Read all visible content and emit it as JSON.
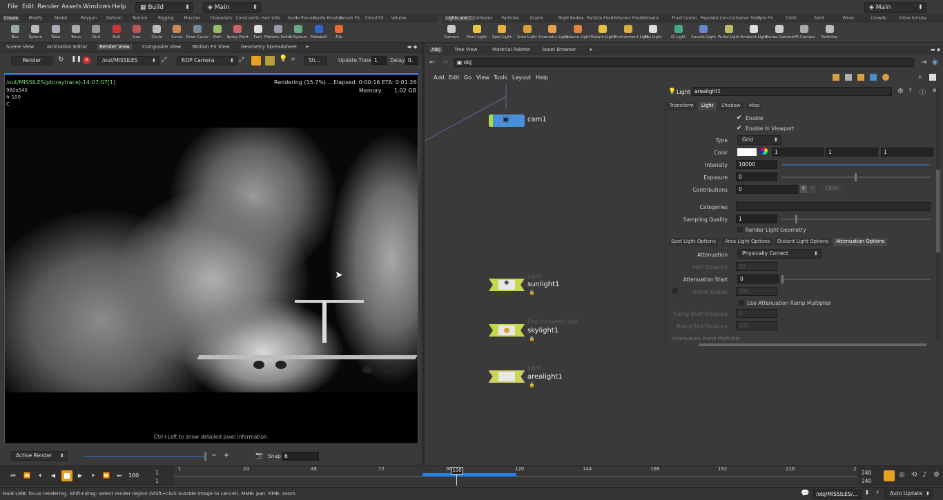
{
  "menubar": {
    "items": [
      "File",
      "Edit",
      "Render",
      "Assets",
      "Windows",
      "Help"
    ],
    "desktop": "Build",
    "context": "Main",
    "right_context": "Main"
  },
  "shelf_left": {
    "tabs": [
      "Create",
      "Modify",
      "Model",
      "Polygon",
      "Deform",
      "Texture",
      "Rigging",
      "Muscles",
      "Characters",
      "Constraints",
      "Hair Utils",
      "Guide Process",
      "Guide Brushes",
      "Terrain FX",
      "Cloud FX",
      "Volume"
    ],
    "tools": [
      "Box",
      "Sphere",
      "Tube",
      "Torus",
      "Grid",
      "Null",
      "Line",
      "Circle",
      "Curve",
      "Draw Curve",
      "Path",
      "Spray Paint",
      "Font",
      "Platonic Solids",
      "L-System",
      "Metaball",
      "File"
    ]
  },
  "shelf_right": {
    "tabs": [
      "Lights and C.",
      "Collisions",
      "Particles",
      "Grains",
      "Rigid Bodies",
      "Particle Fluids",
      "Viscous Fluids",
      "Oceans",
      "Fluid Contai.",
      "Populate Con.",
      "Container Tools",
      "Pyro FX",
      "Cloth",
      "Solid",
      "Wires",
      "Crowds",
      "Drive Simula."
    ],
    "tools": [
      "Camera",
      "Point Light",
      "Spot Light",
      "Area Light",
      "Geometry Light",
      "Volume Light",
      "Distant Light",
      "Environment Light",
      "Sky Light",
      "GI Light",
      "Caustic Light",
      "Portal Light",
      "Ambient Light",
      "Stereo Camera",
      "VR Camera",
      "Switcher"
    ]
  },
  "left_pane": {
    "tabs": [
      "Scene View",
      "Animation Editor",
      "Render View",
      "Composite View",
      "Motion FX View",
      "Geometry Spreadsheet"
    ],
    "toolbar": {
      "render": "Render",
      "rop_path": "/out/MISSILES",
      "camera": "ROP Camera",
      "sh": "Sh...",
      "update_time_label": "Update Time",
      "update_time": "1",
      "delay_label": "Delay",
      "delay": "0."
    },
    "overlay": {
      "title": "/out/MISSILES(pbrraytrace)-14:07:07[1]",
      "res": "960x540",
      "frame": "fr 100",
      "channel": "C",
      "status": "Rendering (15.7%)...",
      "elapsed": "Elapsed: 0:00:16",
      "eta": "ETA: 0:01:26",
      "memory_label": "Memory:",
      "memory": "1.02 GB",
      "hint": "Ctrl+Left to show detailed pixel information."
    },
    "bottom": {
      "active_render": "Active Render",
      "snap_label": "Snap",
      "snap": "6"
    }
  },
  "right_pane": {
    "tabs": [
      "/obj",
      "Tree View",
      "Material Palette",
      "Asset Browser"
    ],
    "path": "obj",
    "menu": [
      "Add",
      "Edit",
      "Go",
      "View",
      "Tools",
      "Layout",
      "Help"
    ],
    "nodes": [
      {
        "type": "",
        "name": "cam1",
        "color": "#4a90d9"
      },
      {
        "type": "Light",
        "name": "sunlight1",
        "color": "#c8d84a"
      },
      {
        "type": "Environment Light",
        "name": "skylight1",
        "color": "#c8d84a"
      },
      {
        "type": "Light",
        "name": "arealight1",
        "color": "#c8d84a"
      }
    ]
  },
  "params": {
    "node_type": "Light",
    "node_name": "arealight1",
    "tabs": [
      "Transform",
      "Light",
      "Shadow",
      "Misc"
    ],
    "enable": "Enable",
    "enable_viewport": "Enable In Viewport",
    "type_label": "Type",
    "type": "Grid",
    "color_label": "Color",
    "color": [
      "1",
      "1",
      "1"
    ],
    "intensity_label": "Intensity",
    "intensity": "10000",
    "exposure_label": "Exposure",
    "exposure": "0",
    "contributions_label": "Contributions",
    "contributions": "0",
    "clear": "Clear",
    "categories_label": "Categories",
    "sampling_label": "Sampling Quality",
    "sampling": "1",
    "render_geo": "Render Light Geometry",
    "subtabs": [
      "Spot Light Options",
      "Area Light Options",
      "Distant Light Options",
      "Attenuation Options"
    ],
    "attenuation_label": "Attenuation",
    "attenuation": "Physically Correct",
    "half_distance_label": "Half Distance",
    "half_distance": "10",
    "att_start_label": "Attenuation Start",
    "att_start": "0",
    "active_radius_label": "Active Radius",
    "active_radius": "100",
    "use_ramp": "Use Attenuation Ramp Multiplier",
    "ramp_start_label": "Ramp Start Distance",
    "ramp_start": "0",
    "ramp_end_label": "Ramp End Distance",
    "ramp_end": "100",
    "ramp_mult_label": "Attenuation Ramp Multiplier"
  },
  "timeline": {
    "current_frame": "100",
    "start": "1",
    "start2": "1",
    "end": "240",
    "end2": "240",
    "ticks": [
      "1",
      "24",
      "48",
      "72",
      "96",
      "120",
      "144",
      "168",
      "192",
      "216",
      "2"
    ],
    "playhead": "100"
  },
  "status": {
    "hint": "Hold LMB: focus rendering. Shift+drag: select render region (Shift+click outside image to cancel). MMB: pan. RMB: zoom.",
    "path": "/obj/MISSILES/...",
    "update": "Auto Update"
  },
  "colors": {
    "accent": "#e8a020",
    "wire": "#5a6a9a",
    "progress": "#2a7de1"
  }
}
